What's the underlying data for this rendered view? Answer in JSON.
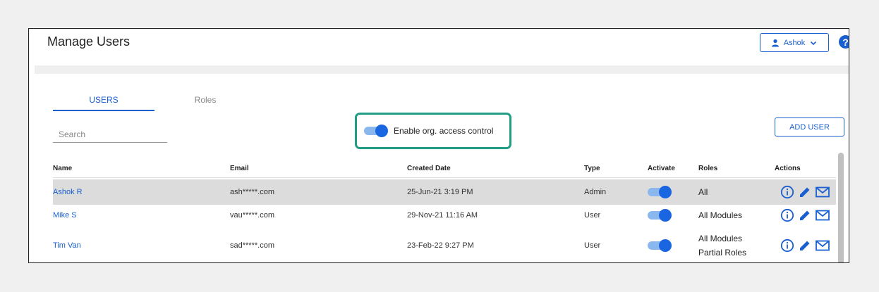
{
  "header": {
    "title": "Manage Users",
    "user_name": "Ashok",
    "help_glyph": "?"
  },
  "tabs": [
    {
      "label": "USERS",
      "active": true
    },
    {
      "label": "Roles",
      "active": false
    }
  ],
  "search": {
    "placeholder": "Search",
    "value": ""
  },
  "access_control": {
    "label": "Enable org. access control",
    "enabled": true
  },
  "add_user_label": "ADD USER",
  "table": {
    "columns": [
      "Name",
      "Email",
      "Created Date",
      "Type",
      "Activate",
      "Roles",
      "Actions"
    ],
    "rows": [
      {
        "name": "Ashok R",
        "email": "ash*****.com",
        "created": "25-Jun-21 3:19 PM",
        "type": "Admin",
        "active": true,
        "roles": [
          "All"
        ],
        "selected": true
      },
      {
        "name": "Mike S",
        "email": "vau*****.com",
        "created": "29-Nov-21 11:16 AM",
        "type": "User",
        "active": true,
        "roles": [
          "All Modules"
        ],
        "selected": false
      },
      {
        "name": "Tim Van",
        "email": "sad*****.com",
        "created": "23-Feb-22 9:27 PM",
        "type": "User",
        "active": true,
        "roles": [
          "All Modules",
          "Partial Roles"
        ],
        "selected": false
      }
    ]
  },
  "icons": {
    "user": "user-icon",
    "dropdown": "chevron-down-icon",
    "info": "info-icon",
    "edit": "pencil-icon",
    "email": "mail-icon"
  },
  "colors": {
    "accent": "#1a5fd0",
    "highlight_border": "#1f9e85",
    "selected_row": "#dcdcdc"
  }
}
